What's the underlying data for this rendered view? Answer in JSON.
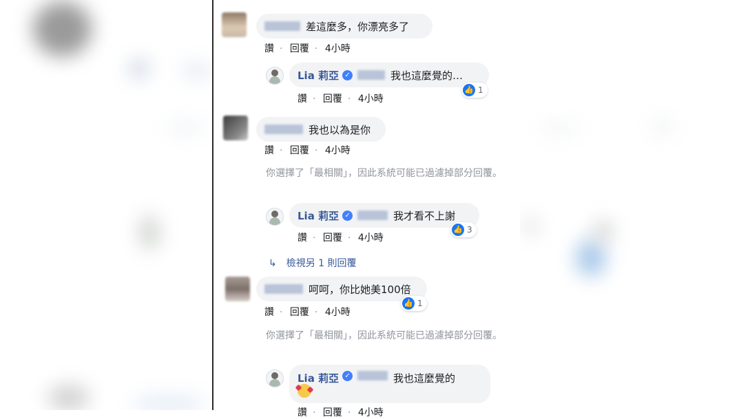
{
  "colors": {
    "link": "#385898",
    "meta": "#90949c",
    "bubble": "#f2f3f5",
    "like": "#1877f2",
    "verified": "#4080ff"
  },
  "comments": [
    {
      "text": "差這麼多，你漂亮多了",
      "actions": {
        "like": "讚",
        "reply": "回覆",
        "time": "4小時"
      }
    },
    {
      "author": "Lia 莉亞",
      "text": "我也這麼覺的…",
      "reactions": "1",
      "actions": {
        "like": "讚",
        "reply": "回覆",
        "time": "4小時"
      }
    },
    {
      "text": "我也以為是你",
      "actions": {
        "like": "讚",
        "reply": "回覆",
        "time": "4小時"
      }
    },
    {
      "author": "Lia 莉亞",
      "text": "我才看不上謝",
      "reactions": "3",
      "actions": {
        "like": "讚",
        "reply": "回覆",
        "time": "4小時"
      }
    },
    {
      "text": "呵呵，你比她美100倍",
      "reactions": "1",
      "actions": {
        "like": "讚",
        "reply": "回覆",
        "time": "4小時"
      }
    },
    {
      "author": "Lia 莉亞",
      "text": "我也這麼覺的",
      "actions": {
        "like": "讚",
        "reply": "回覆",
        "time": "4小時"
      }
    }
  ],
  "filter_notice": "你選擇了「最相關」，因此系統可能已過濾掉部分回覆。",
  "view_more": "檢視另 1 則回覆",
  "icons": {
    "verified": "verified-check-icon",
    "like": "thumbs-up-icon",
    "reply_arrow": "reply-arrow-icon",
    "emoji": "smiling-face-with-hearts-icon"
  }
}
